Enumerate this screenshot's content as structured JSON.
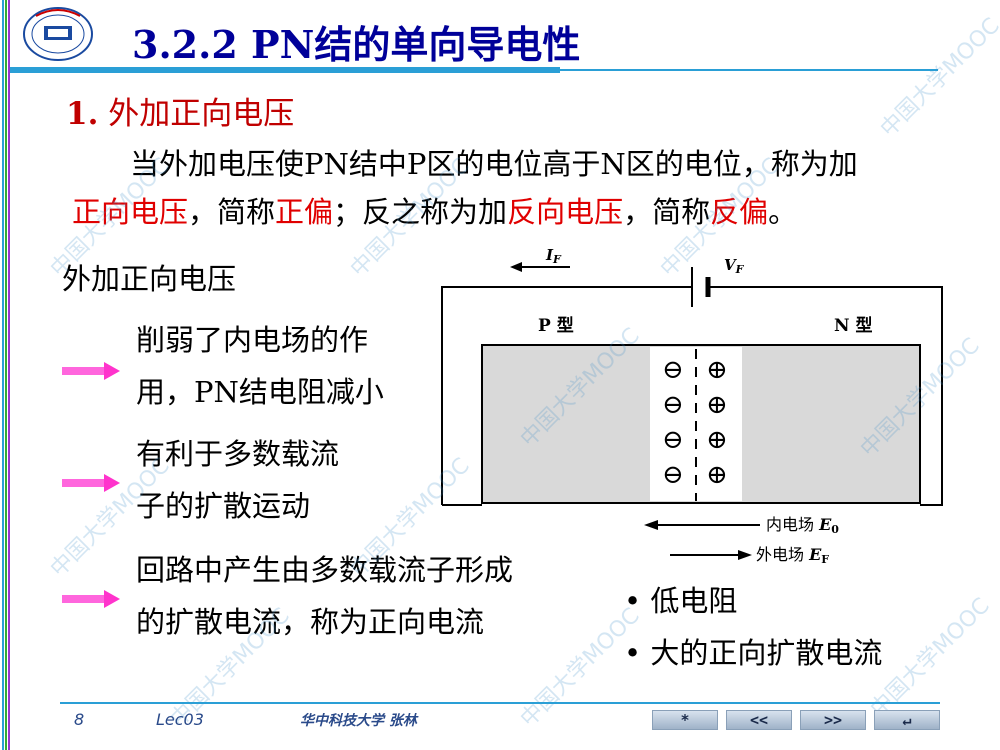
{
  "title": "3.2.2  PN结的单向导电性",
  "section": {
    "num": "1.",
    "text": "外加正向电压"
  },
  "paragraph": {
    "p1": "当外加电压使PN结中P区的电位高于N区的电位，称为加",
    "p2a": "正向电压",
    "p2b": "，简称",
    "p2c": "正偏",
    "p2d": "；反之称为加",
    "p2e": "反向电压",
    "p2f": "，简称",
    "p2g": "反偏",
    "p2h": "。"
  },
  "subtitle": "外加正向电压",
  "effects": [
    {
      "l1": "削弱了内电场的作",
      "l2": "用，PN结电阻减小"
    },
    {
      "l1": "有利于多数载流",
      "l2": "子的扩散运动"
    },
    {
      "l1": "回路中产生由多数载流子形成",
      "l2": "的扩散电流，称为正向电流"
    }
  ],
  "diagram": {
    "current_label": "I",
    "current_sub": "F",
    "voltage_label": "V",
    "voltage_sub": "F",
    "p_label": "P 型",
    "n_label": "N 型",
    "inner_field": "内电场 ",
    "inner_sym": "E",
    "inner_sub": "0",
    "outer_field": "外电场 ",
    "outer_sym": "E",
    "outer_sub": "F",
    "minus": "⊖",
    "plus": "⊕"
  },
  "results": [
    "低电阻",
    "大的正向扩散电流"
  ],
  "footer": {
    "page": "8",
    "lecture": "Lec03",
    "author": "华中科技大学   张林",
    "nav": [
      "*",
      "<<",
      ">>",
      "↵"
    ]
  },
  "watermark": "中国大学MOOC",
  "colors": {
    "title": "#000099",
    "accent": "#2a9fd6",
    "red": "#e00000",
    "arrow": "#ff33cc"
  }
}
